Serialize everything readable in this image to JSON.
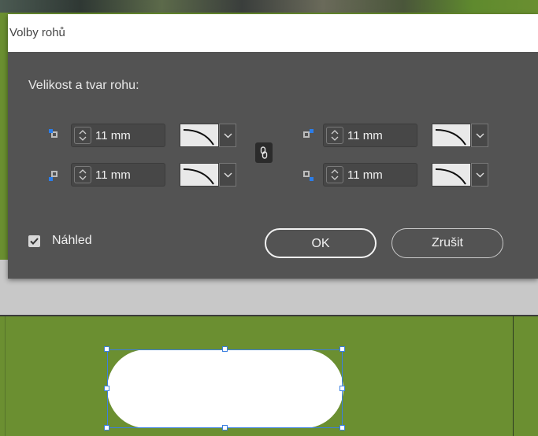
{
  "dialog": {
    "title": "Volby rohů",
    "section_label": "Velikost a tvar rohu:",
    "corners": [
      {
        "id": "top-left",
        "value": "11 mm"
      },
      {
        "id": "top-right",
        "value": "11 mm"
      },
      {
        "id": "bottom-left",
        "value": "11 mm"
      },
      {
        "id": "bottom-right",
        "value": "11 mm"
      }
    ],
    "link_icon": "chain-link-icon",
    "preview": {
      "label": "Náhled",
      "checked": true
    },
    "buttons": {
      "ok": "OK",
      "cancel": "Zrušit"
    }
  },
  "colors": {
    "dialog_bg": "#535353",
    "accent": "#2b7de9",
    "canvas": "#6b8f31"
  }
}
